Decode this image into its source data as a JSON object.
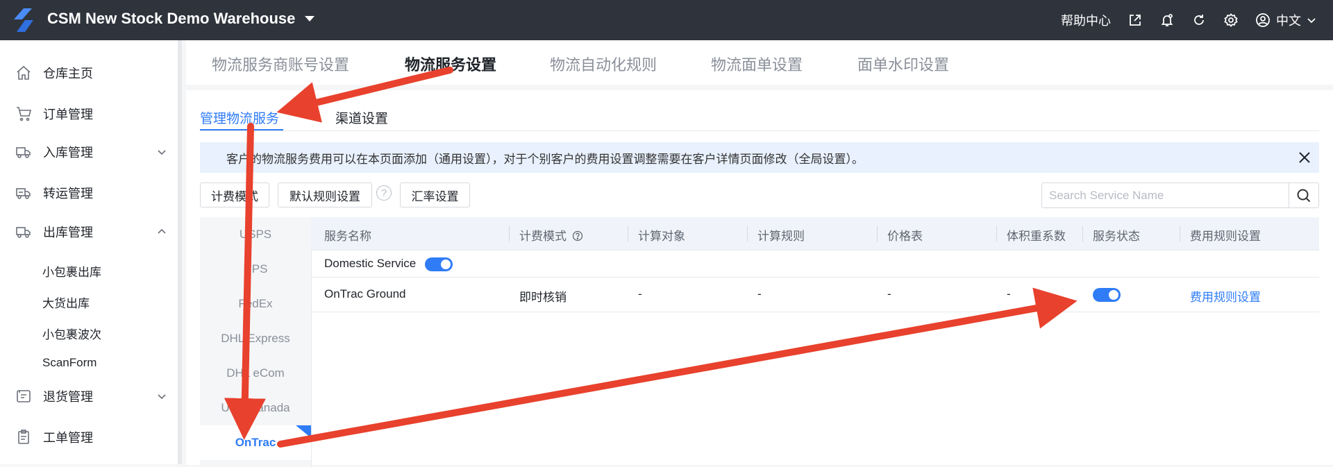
{
  "topbar": {
    "warehouse_name": "CSM New Stock Demo Warehouse",
    "help_center": "帮助中心",
    "language": "中文",
    "icons": [
      "export-icon",
      "notification-bell-icon",
      "refresh-icon",
      "settings-icon",
      "user-icon"
    ]
  },
  "sidebar": {
    "items": [
      {
        "label": "仓库主页",
        "icon": "home-icon"
      },
      {
        "label": "订单管理",
        "icon": "cart-icon"
      },
      {
        "label": "入库管理",
        "icon": "inbound-truck-icon"
      },
      {
        "label": "转运管理",
        "icon": "transfer-truck-icon"
      },
      {
        "label": "出库管理",
        "icon": "outbound-truck-icon"
      },
      {
        "label": "退货管理",
        "icon": "return-icon"
      },
      {
        "label": "工单管理",
        "icon": "clipboard-icon"
      }
    ],
    "outbound_sub": [
      "小包裹出库",
      "大货出库",
      "小包裹波次",
      "ScanForm"
    ]
  },
  "top_tabs": [
    "物流服务商账号设置",
    "物流服务设置",
    "物流自动化规则",
    "物流面单设置",
    "面单水印设置"
  ],
  "active_top_tab": "物流服务设置",
  "sub_tabs": [
    "管理物流服务",
    "渠道设置"
  ],
  "notice": "客户的物流服务费用可以在本页面添加（通用设置），对于个别客户的费用设置调整需要在客户详情页面修改（全局设置）。",
  "buttons": {
    "billing_mode": "计费模式",
    "default_rules": "默认规则设置",
    "help": "?",
    "exchange_rate": "汇率设置"
  },
  "search": {
    "placeholder": "Search Service Name"
  },
  "carriers": [
    "USPS",
    "UPS",
    "FedEx",
    "DHL Express",
    "DHL eCom",
    "UPS Canada",
    "OnTrac"
  ],
  "active_carrier": "OnTrac",
  "table": {
    "headers": [
      "服务名称",
      "计费模式",
      "计算对象",
      "计算规则",
      "价格表",
      "体积重系数",
      "服务状态",
      "费用规则设置"
    ],
    "group": {
      "label": "Domestic Service",
      "enabled": true
    },
    "rows": [
      {
        "service": "OnTrac Ground",
        "billing_mode": "即时核销",
        "calc_object": "-",
        "calc_rule": "-",
        "price_table": "-",
        "dim_factor": "-",
        "status_enabled": true,
        "action": "费用规则设置"
      }
    ]
  },
  "colors": {
    "accent": "#2f7cf6",
    "topbar": "#2f333b",
    "annotation_arrow": "#e8412d"
  }
}
